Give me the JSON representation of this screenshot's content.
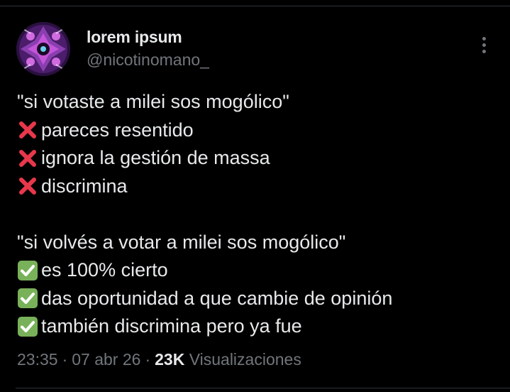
{
  "author": {
    "display_name": "lorem ipsum",
    "handle": "@nicotinomano_"
  },
  "tweet": {
    "lines": [
      {
        "marker": "none",
        "text": "\"si votaste a milei sos mogólico\""
      },
      {
        "marker": "cross",
        "text": "pareces resentido"
      },
      {
        "marker": "cross",
        "text": "ignora la gestión de massa"
      },
      {
        "marker": "cross",
        "text": "discrimina"
      },
      {
        "marker": "blank",
        "text": ""
      },
      {
        "marker": "none",
        "text": "\"si volvés a votar a milei sos mogólico\""
      },
      {
        "marker": "check",
        "text": "es 100% cierto"
      },
      {
        "marker": "check",
        "text": "das oportunidad a que cambie de opinión"
      },
      {
        "marker": "check",
        "text": "también discrimina pero ya fue"
      }
    ]
  },
  "meta": {
    "time": "23:35",
    "separator": "·",
    "date": "07 abr 26",
    "views_count": "23K",
    "views_label": "Visualizaciones"
  },
  "icons": {
    "cross": "cross-mark-icon",
    "check": "check-mark-button-icon",
    "more": "more-options-icon"
  },
  "colors": {
    "background": "#000000",
    "primary_text": "#e7e9ea",
    "secondary_text": "#71767b",
    "divider": "#2f3336",
    "cross": "#e8374b",
    "check_bg": "#78b159"
  }
}
